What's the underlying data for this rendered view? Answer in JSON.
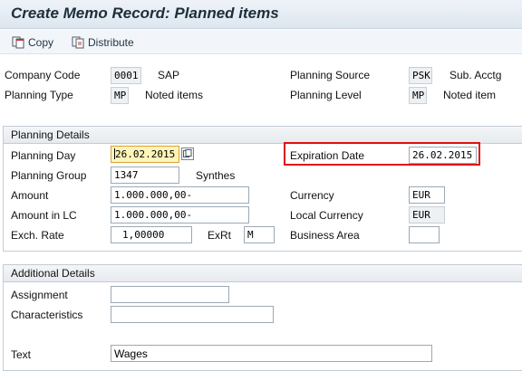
{
  "window": {
    "title": "Create Memo Record: Planned items"
  },
  "toolbar": {
    "copy_label": "Copy",
    "distribute_label": "Distribute"
  },
  "header": {
    "company_code_label": "Company Code",
    "company_code_value": "0001",
    "company_code_text": "SAP",
    "planning_type_label": "Planning Type",
    "planning_type_value": "MP",
    "planning_type_text": "Noted items",
    "planning_source_label": "Planning Source",
    "planning_source_value": "PSK",
    "planning_source_text": "Sub. Acctg",
    "planning_level_label": "Planning Level",
    "planning_level_value": "MP",
    "planning_level_text": "Noted item"
  },
  "planning_details": {
    "title": "Planning Details",
    "planning_day_label": "Planning Day",
    "planning_day_value": "26.02.2015",
    "expiration_date_label": "Expiration Date",
    "expiration_date_value": "26.02.2015",
    "planning_group_label": "Planning Group",
    "planning_group_value": "1347",
    "planning_group_text": "Synthes",
    "amount_label": "Amount",
    "amount_value": "1.000.000,00-",
    "currency_label": "Currency",
    "currency_value": "EUR",
    "amount_lc_label": "Amount in LC",
    "amount_lc_value": "1.000.000,00-",
    "local_currency_label": "Local Currency",
    "local_currency_value": "EUR",
    "exch_rate_label": "Exch. Rate",
    "exch_rate_value": "1,00000",
    "exrt_label": "ExRt",
    "exrt_value": "M",
    "business_area_label": "Business Area",
    "business_area_value": ""
  },
  "additional_details": {
    "title": "Additional Details",
    "assignment_label": "Assignment",
    "assignment_value": "",
    "characteristics_label": "Characteristics",
    "characteristics_value": "",
    "text_label": "Text",
    "text_value": "Wages"
  },
  "colors": {
    "highlight": "#e01010",
    "focus_field": "#fff5b8"
  }
}
